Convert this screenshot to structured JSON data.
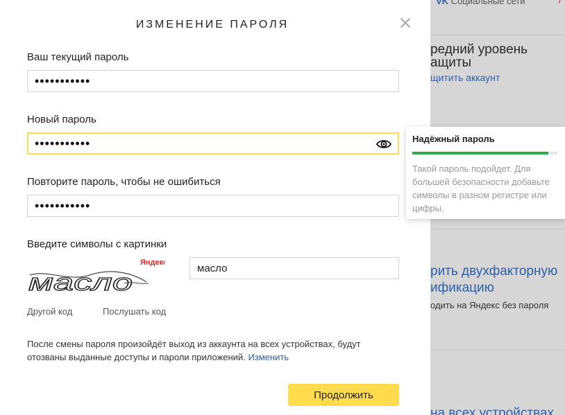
{
  "background": {
    "top_blue": "VK",
    "top_text": "Социальные сети",
    "top_red": "/",
    "section1_title": "редний уровень",
    "section1_title2": "ащиты",
    "section1_link": "щитить аккаунт",
    "section2_title": "рить двухфакторную",
    "section2_title2": "ификацию",
    "section2_sub": "одить на Яндекс без пароля",
    "section3_title": "на всех устройствах"
  },
  "modal": {
    "title": "ИЗМЕНЕНИЕ ПАРОЛЯ",
    "current_label": "Ваш текущий пароль",
    "current_value": "•••••••••••",
    "new_label": "Новый пароль",
    "new_value": "•••••••••••",
    "repeat_label": "Повторите пароль, чтобы не ошибиться",
    "repeat_value": "•••••••••••",
    "captcha_label": "Введите символы с картинки",
    "captcha_brand": "Яндекс",
    "captcha_image_text": "масло",
    "captcha_value": "масло",
    "other_code": "Другой код",
    "listen_code": "Послушать код",
    "note_text": "После смены пароля произойдёт выход из аккаунта на всех устройствах, будут отозваны выданные доступы и пароли приложений.",
    "note_link": "Изменить",
    "continue_label": "Продолжить"
  },
  "tooltip": {
    "title": "Надёжный пароль",
    "strength_fraction": 0.94,
    "strength_color": "#2fa84f",
    "text": "Такой пароль подойдет. Для большей безопасности добавьте символы в разном регистре или цифры."
  },
  "colors": {
    "accent": "#ffdb4d",
    "link": "#2a5ea8"
  },
  "icons": {
    "close": "close-icon",
    "eye": "eye-icon"
  }
}
